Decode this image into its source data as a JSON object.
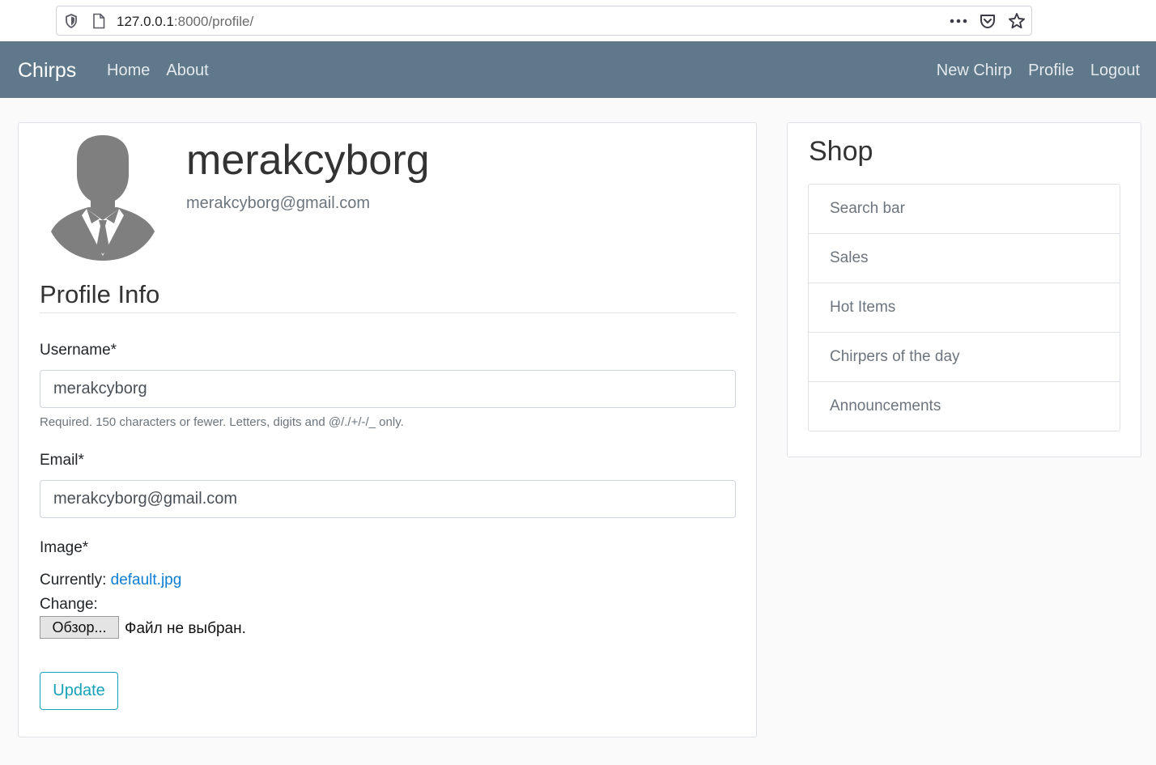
{
  "browser": {
    "url_host": "127.0.0.1",
    "url_rest": ":8000/profile/",
    "icons": [
      "shield-icon",
      "page-icon",
      "more-icon",
      "pocket-icon",
      "star-icon"
    ]
  },
  "navbar": {
    "brand": "Chirps",
    "left_links": [
      "Home",
      "About"
    ],
    "right_links": [
      "New Chirp",
      "Profile",
      "Logout"
    ]
  },
  "profile": {
    "username": "merakcyborg",
    "email": "merakcyborg@gmail.com",
    "section_title": "Profile Info",
    "form": {
      "username_label": "Username*",
      "username_value": "merakcyborg",
      "username_help": "Required. 150 characters or fewer. Letters, digits and @/./+/-/_ only.",
      "email_label": "Email*",
      "email_value": "merakcyborg@gmail.com",
      "image_label": "Image*",
      "currently_label": "Currently:",
      "currently_file": "default.jpg",
      "change_label": "Change:",
      "browse_button": "Обзор...",
      "file_status": "Файл не выбран.",
      "update_button": "Update"
    }
  },
  "shop": {
    "title": "Shop",
    "items": [
      "Search bar",
      "Sales",
      "Hot Items",
      "Chirpers of the day",
      "Announcements"
    ]
  },
  "colors": {
    "navbar_bg": "#5f788a",
    "accent": "#17a2b8",
    "link": "#0b7dd3"
  }
}
